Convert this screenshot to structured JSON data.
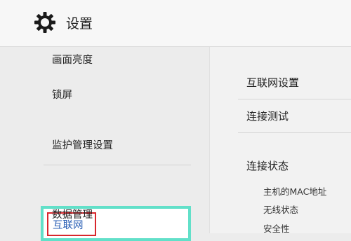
{
  "header": {
    "icon": "gear-icon",
    "title": "设置"
  },
  "sidebar": {
    "items": [
      {
        "label": "画面亮度"
      },
      {
        "label": "锁屏"
      },
      {
        "label": "监护管理设置"
      },
      {
        "label": "互联网",
        "selected": true
      },
      {
        "label": "数据管理"
      }
    ]
  },
  "content": {
    "items": [
      {
        "label": "互联网设置"
      },
      {
        "label": "连接测试"
      },
      {
        "label": "连接状态"
      }
    ],
    "status_details": [
      {
        "label": "主机的MAC地址"
      },
      {
        "label": "无线状态"
      },
      {
        "label": "安全性"
      }
    ]
  },
  "colors": {
    "selection_border": "#62e0c9",
    "highlight_box": "#d8262c",
    "selected_text": "#2a5fb5"
  }
}
